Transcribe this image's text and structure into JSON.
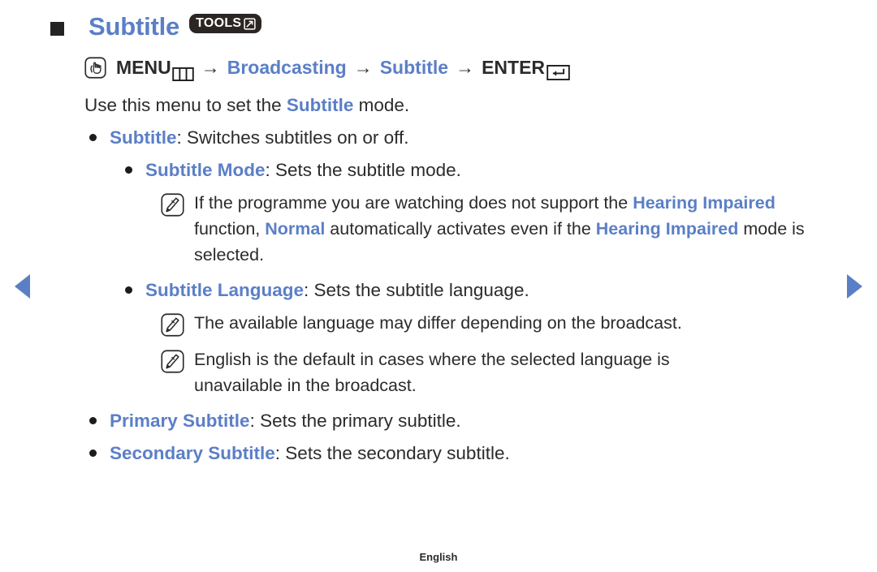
{
  "nav": {
    "prev_label": "previous-page",
    "next_label": "next-page"
  },
  "header": {
    "title": "Subtitle",
    "tools_badge": "TOOLS",
    "tools_icon": "box-arrow-icon",
    "bullet_icon": "square-bullet-icon"
  },
  "menu_path": {
    "hand_icon": "hand-press-icon",
    "menu_label": "MENU",
    "menu_icon": "menu-grid-icon",
    "arrow1": "→",
    "item1": "Broadcasting",
    "arrow2": "→",
    "item2": "Subtitle",
    "arrow3": "→",
    "enter_label": "ENTER",
    "enter_icon": "enter-return-icon"
  },
  "intro": {
    "prefix": "Use this menu to set the ",
    "highlight": "Subtitle",
    "suffix": " mode."
  },
  "items": [
    {
      "bullet_icon": "round-bullet-icon",
      "term": "Subtitle",
      "desc": ": Switches subtitles on or off."
    },
    {
      "bullet_icon": "round-bullet-icon",
      "term": "Subtitle Mode",
      "desc": ": Sets the subtitle mode."
    },
    {
      "bullet_icon": "round-bullet-icon",
      "term": "Subtitle Language",
      "desc": ": Sets the subtitle language."
    },
    {
      "bullet_icon": "round-bullet-icon",
      "term": "Primary Subtitle",
      "desc": ": Sets the primary subtitle."
    },
    {
      "bullet_icon": "round-bullet-icon",
      "term": "Secondary Subtitle",
      "desc": ": Sets the secondary subtitle."
    }
  ],
  "notes": {
    "note_icon": "note-pencil-icon",
    "hearing": {
      "p1": "If the programme you are watching does not support the ",
      "h1": "Hearing Impaired",
      "p2": " function, ",
      "h2": "Normal",
      "p3": " automatically activates even if the ",
      "h3": "Hearing Impaired",
      "p4": " mode is selected."
    },
    "language_note": "The available language may differ depending on the broadcast.",
    "english_note": "English is the default in cases where the selected language is unavailable in the broadcast."
  },
  "footer": {
    "language": "English"
  },
  "colors": {
    "accent_blue": "#5b7fc7",
    "body_text": "#2b2b2b",
    "badge_bg": "#2b2523",
    "bullet_dark": "#1c1c1c"
  }
}
